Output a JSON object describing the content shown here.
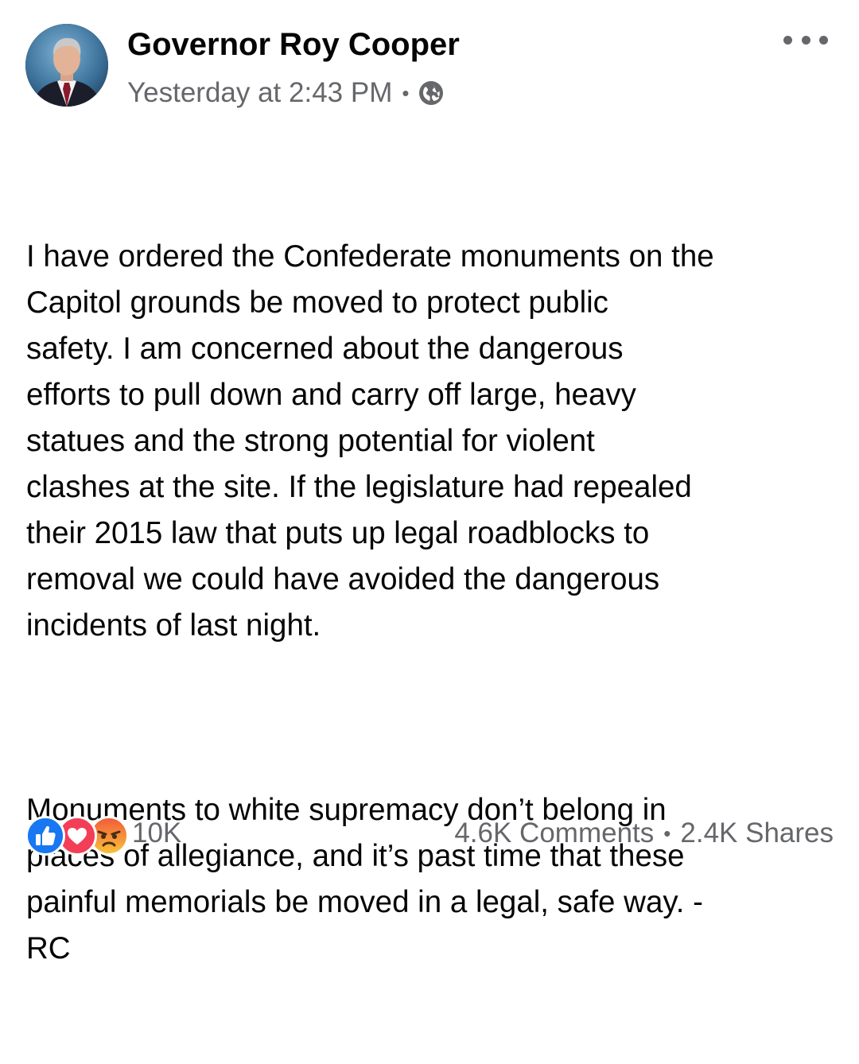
{
  "post": {
    "author": {
      "name": "Governor Roy Cooper",
      "avatar_icon": "profile-photo"
    },
    "meta": {
      "timestamp": "Yesterday at 2:43 PM",
      "separator": "•",
      "audience_icon": "globe-icon"
    },
    "more_icon": "more-horizontal-icon",
    "body": {
      "paragraph_1": "I have ordered the Confederate monuments on the\nCapitol grounds be moved to protect public\nsafety. I am concerned about the dangerous\nefforts to pull down and carry off large, heavy\nstatues and the strong potential for violent\nclashes at the site. If the legislature had repealed\ntheir 2015 law that puts up legal roadblocks to\nremoval we could have avoided the dangerous\nincidents of last night.",
      "paragraph_2": "Monuments to white supremacy don’t belong in\nplaces of allegiance, and it’s past time that these\npainful memorials be moved in a legal, safe way. -\nRC"
    },
    "reactions": {
      "icons": [
        "like-icon",
        "love-icon",
        "angry-icon"
      ],
      "count": "10K"
    },
    "stats": {
      "comments": "4.6K Comments",
      "separator": "•",
      "shares": "2.4K Shares"
    }
  },
  "colors": {
    "text_primary": "#050505",
    "text_secondary": "#65676b",
    "like_blue": "#1877f2",
    "love_red": "#f33e58",
    "angry_orange": "#f7714c"
  }
}
